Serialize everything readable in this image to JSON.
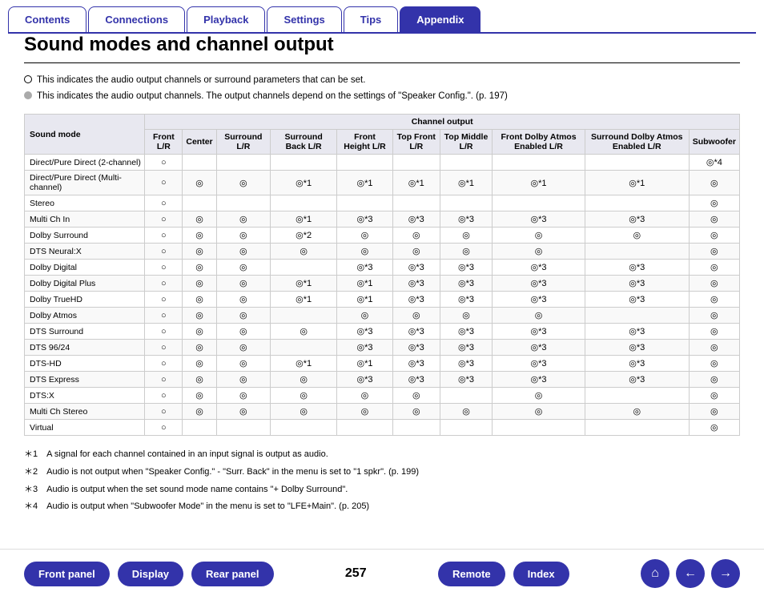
{
  "nav": {
    "tabs": [
      {
        "label": "Contents",
        "active": false
      },
      {
        "label": "Connections",
        "active": false
      },
      {
        "label": "Playback",
        "active": false
      },
      {
        "label": "Settings",
        "active": false
      },
      {
        "label": "Tips",
        "active": false
      },
      {
        "label": "Appendix",
        "active": true
      }
    ]
  },
  "page": {
    "title": "Sound modes and channel output",
    "legend": [
      "This indicates the audio output channels or surround parameters that can be set.",
      "This indicates the audio output channels. The output channels depend on the settings of \"Speaker Config.\".  (p. 197)"
    ]
  },
  "table": {
    "header_main": "Channel output",
    "col_soundmode": "Sound mode",
    "columns": [
      "Front L/R",
      "Center",
      "Surround L/R",
      "Surround Back L/R",
      "Front Height L/R",
      "Top Front L/R",
      "Top Middle L/R",
      "Front Dolby Atmos Enabled L/R",
      "Surround Dolby Atmos Enabled L/R",
      "Subwoofer"
    ],
    "rows": [
      {
        "mode": "Direct/Pure Direct (2-channel)",
        "cells": [
          "○",
          "",
          "",
          "",
          "",
          "",
          "",
          "",
          "",
          "◎*4"
        ]
      },
      {
        "mode": "Direct/Pure Direct (Multi-channel)",
        "cells": [
          "○",
          "◎",
          "◎",
          "◎*1",
          "◎*1",
          "◎*1",
          "◎*1",
          "◎*1",
          "◎*1",
          "◎"
        ]
      },
      {
        "mode": "Stereo",
        "cells": [
          "○",
          "",
          "",
          "",
          "",
          "",
          "",
          "",
          "",
          "◎"
        ]
      },
      {
        "mode": "Multi Ch In",
        "cells": [
          "○",
          "◎",
          "◎",
          "◎*1",
          "◎*3",
          "◎*3",
          "◎*3",
          "◎*3",
          "◎*3",
          "◎"
        ]
      },
      {
        "mode": "Dolby Surround",
        "cells": [
          "○",
          "◎",
          "◎",
          "◎*2",
          "◎",
          "◎",
          "◎",
          "◎",
          "◎",
          "◎"
        ]
      },
      {
        "mode": "DTS Neural:X",
        "cells": [
          "○",
          "◎",
          "◎",
          "◎",
          "◎",
          "◎",
          "◎",
          "◎",
          "",
          "◎"
        ]
      },
      {
        "mode": "Dolby Digital",
        "cells": [
          "○",
          "◎",
          "◎",
          "",
          "◎*3",
          "◎*3",
          "◎*3",
          "◎*3",
          "◎*3",
          "◎"
        ]
      },
      {
        "mode": "Dolby Digital Plus",
        "cells": [
          "○",
          "◎",
          "◎",
          "◎*1",
          "◎*1",
          "◎*3",
          "◎*3",
          "◎*3",
          "◎*3",
          "◎"
        ]
      },
      {
        "mode": "Dolby TrueHD",
        "cells": [
          "○",
          "◎",
          "◎",
          "◎*1",
          "◎*1",
          "◎*3",
          "◎*3",
          "◎*3",
          "◎*3",
          "◎"
        ]
      },
      {
        "mode": "Dolby Atmos",
        "cells": [
          "○",
          "◎",
          "◎",
          "",
          "◎",
          "◎",
          "◎",
          "◎",
          "",
          "◎"
        ]
      },
      {
        "mode": "DTS Surround",
        "cells": [
          "○",
          "◎",
          "◎",
          "◎",
          "◎*3",
          "◎*3",
          "◎*3",
          "◎*3",
          "◎*3",
          "◎"
        ]
      },
      {
        "mode": "DTS 96/24",
        "cells": [
          "○",
          "◎",
          "◎",
          "",
          "◎*3",
          "◎*3",
          "◎*3",
          "◎*3",
          "◎*3",
          "◎"
        ]
      },
      {
        "mode": "DTS-HD",
        "cells": [
          "○",
          "◎",
          "◎",
          "◎*1",
          "◎*1",
          "◎*3",
          "◎*3",
          "◎*3",
          "◎*3",
          "◎"
        ]
      },
      {
        "mode": "DTS Express",
        "cells": [
          "○",
          "◎",
          "◎",
          "◎",
          "◎*3",
          "◎*3",
          "◎*3",
          "◎*3",
          "◎*3",
          "◎"
        ]
      },
      {
        "mode": "DTS:X",
        "cells": [
          "○",
          "◎",
          "◎",
          "◎",
          "◎",
          "◎",
          "",
          "◎",
          "",
          "◎"
        ]
      },
      {
        "mode": "Multi Ch Stereo",
        "cells": [
          "○",
          "◎",
          "◎",
          "◎",
          "◎",
          "◎",
          "◎",
          "◎",
          "◎",
          "◎"
        ]
      },
      {
        "mode": "Virtual",
        "cells": [
          "○",
          "",
          "",
          "",
          "",
          "",
          "",
          "",
          "",
          "◎"
        ]
      }
    ]
  },
  "footnotes": [
    "＊1　A signal for each channel contained in an input signal is output as audio.",
    "＊2　Audio is not output when \"Speaker Config.\" - \"Surr. Back\" in the menu is set to \"1 spkr\".  (p. 199)",
    "＊3　Audio is output when the set sound mode name contains \"+ Dolby Surround\".",
    "＊4　Audio is output when \"Subwoofer Mode\" in the menu is set to \"LFE+Main\".  (p. 205)"
  ],
  "bottom_nav": {
    "buttons_left": [
      "Front panel",
      "Display",
      "Rear panel",
      "Remote",
      "Index"
    ],
    "page_number": "257",
    "icon_buttons": [
      "⌂",
      "←",
      "→"
    ]
  }
}
